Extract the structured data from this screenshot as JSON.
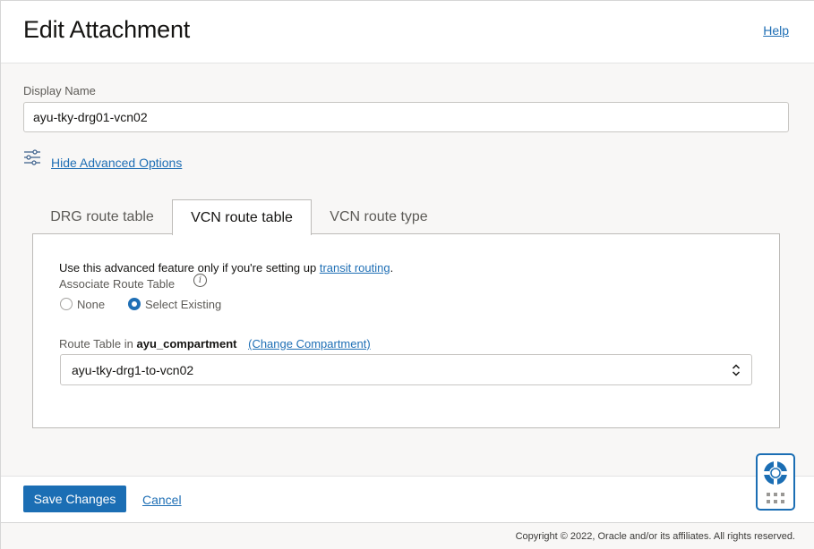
{
  "header": {
    "title": "Edit Attachment",
    "help_label": "Help"
  },
  "form": {
    "display_name_label": "Display Name",
    "display_name_value": "ayu-tky-drg01-vcn02",
    "advanced_toggle_label": "Hide Advanced Options"
  },
  "tabs": [
    {
      "label": "DRG route table",
      "active": false
    },
    {
      "label": "VCN route table",
      "active": true
    },
    {
      "label": "VCN route type",
      "active": false
    }
  ],
  "panel": {
    "note_prefix": "Use this advanced feature only if you're setting up ",
    "note_link": "transit routing",
    "note_suffix": ".",
    "associate_label": "Associate Route Table",
    "info_glyph": "i",
    "radio_none": "None",
    "radio_existing": "Select Existing",
    "selected_radio": "Select Existing",
    "route_table_label": "Route Table in",
    "compartment_name": "ayu_compartment",
    "change_compartment": "(Change Compartment)",
    "route_table_value": "ayu-tky-drg1-to-vcn02"
  },
  "footer": {
    "save_label": "Save Changes",
    "cancel_label": "Cancel",
    "copyright": "Copyright © 2022, Oracle and/or its affiliates. All rights reserved."
  },
  "icons": {
    "advanced": "sliders-icon",
    "info": "info-icon",
    "select": "chevron-updown-icon",
    "help_widget": "lifebuoy-icon",
    "grid": "grid-dots-icon"
  },
  "colors": {
    "accent": "#1b6eb4",
    "link": "#1f6fb5",
    "page_bg": "#f8f7f6"
  }
}
